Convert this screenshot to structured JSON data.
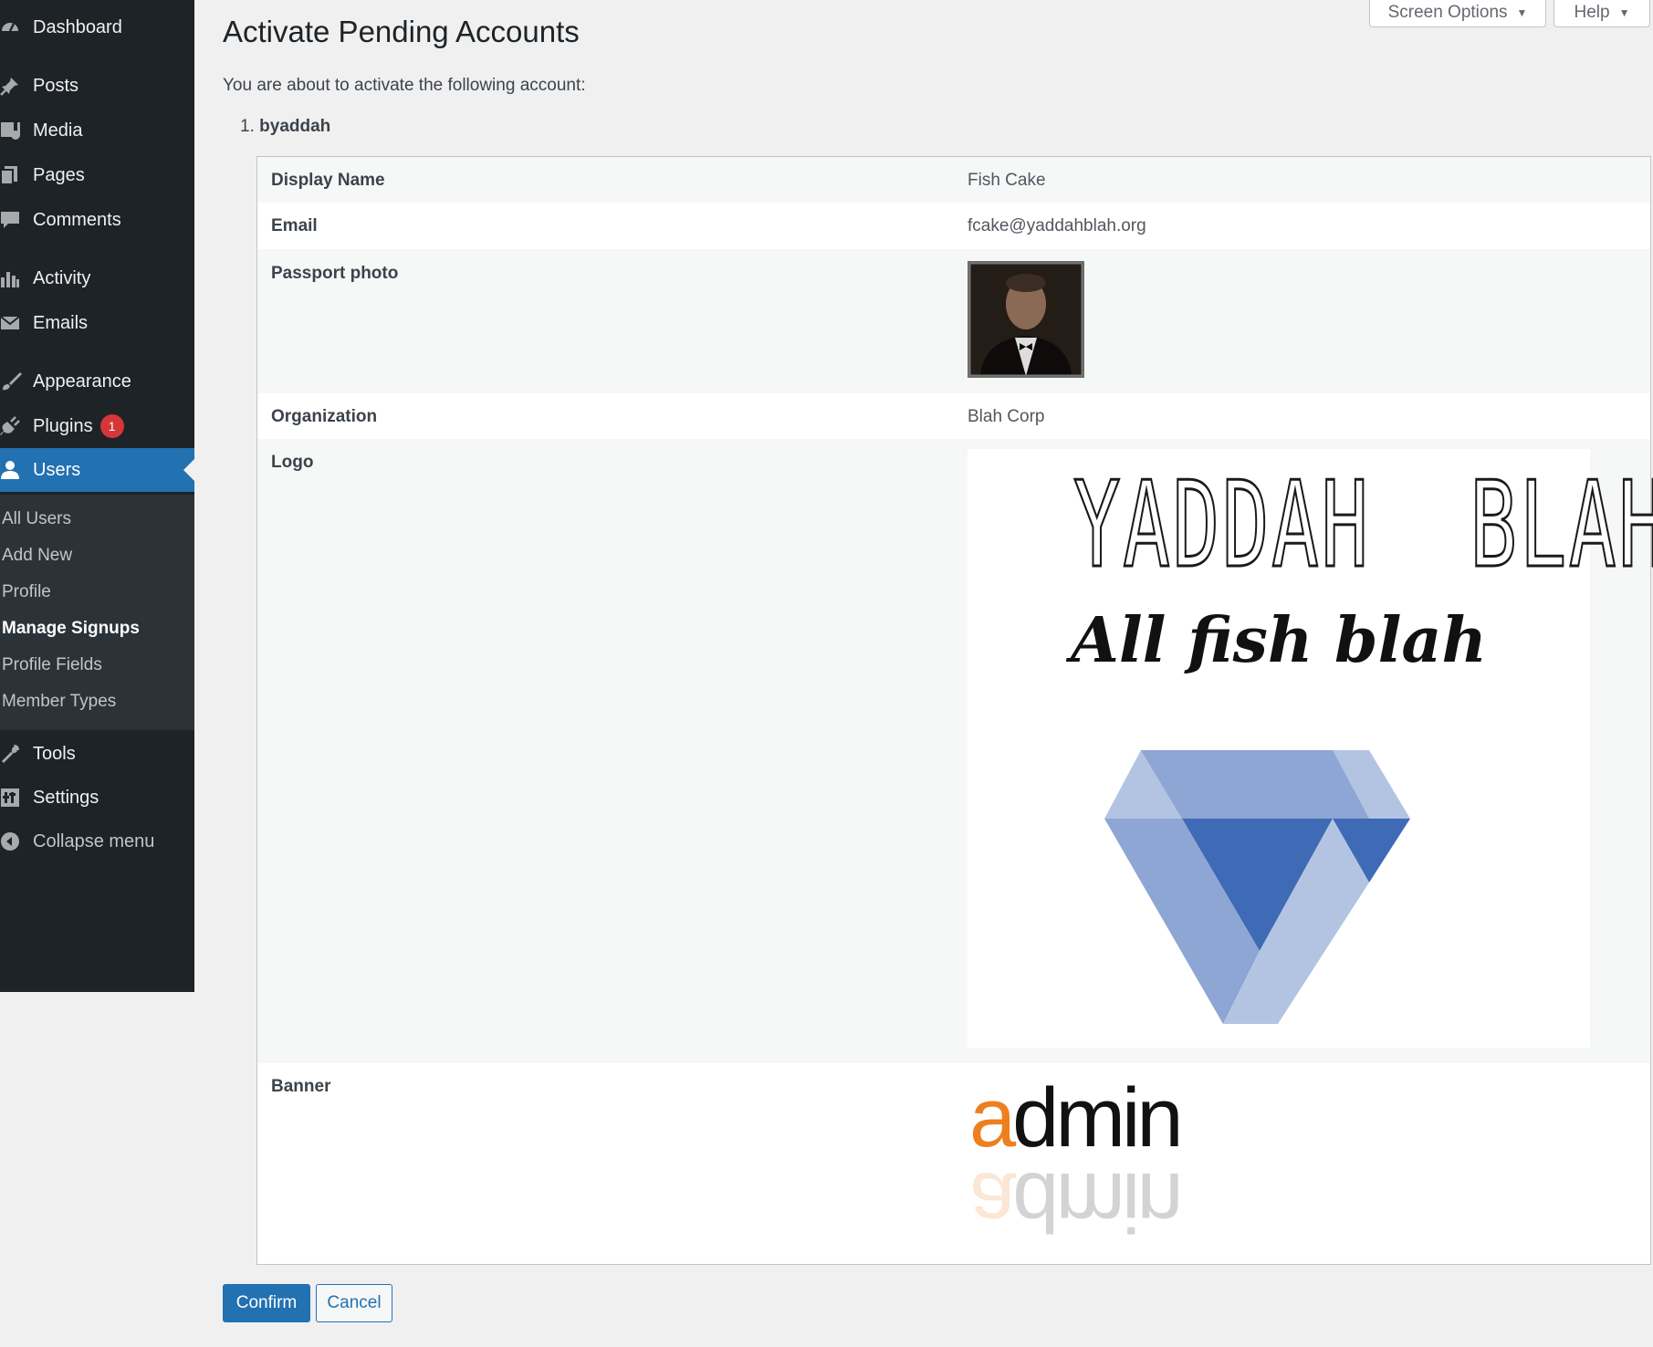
{
  "sidebar": {
    "items": [
      {
        "key": "dashboard",
        "label": "Dashboard",
        "icon": "dashboard-icon"
      },
      {
        "key": "posts",
        "label": "Posts",
        "icon": "pin-icon"
      },
      {
        "key": "media",
        "label": "Media",
        "icon": "media-icon"
      },
      {
        "key": "pages",
        "label": "Pages",
        "icon": "pages-icon"
      },
      {
        "key": "comments",
        "label": "Comments",
        "icon": "comment-icon"
      },
      {
        "key": "activity",
        "label": "Activity",
        "icon": "activity-icon"
      },
      {
        "key": "emails",
        "label": "Emails",
        "icon": "email-icon"
      },
      {
        "key": "appearance",
        "label": "Appearance",
        "icon": "paintbrush-icon"
      },
      {
        "key": "plugins",
        "label": "Plugins",
        "icon": "plugin-icon",
        "badge": "1"
      },
      {
        "key": "users",
        "label": "Users",
        "icon": "user-icon",
        "current": true
      },
      {
        "key": "tools",
        "label": "Tools",
        "icon": "wrench-icon"
      },
      {
        "key": "settings",
        "label": "Settings",
        "icon": "settings-icon"
      },
      {
        "key": "collapse",
        "label": "Collapse menu",
        "icon": "collapse-icon"
      }
    ],
    "submenu": [
      {
        "label": "All Users"
      },
      {
        "label": "Add New"
      },
      {
        "label": "Profile"
      },
      {
        "label": "Manage Signups",
        "active": true
      },
      {
        "label": "Profile Fields"
      },
      {
        "label": "Member Types"
      }
    ]
  },
  "header": {
    "screen_options": "Screen Options",
    "help": "Help"
  },
  "main": {
    "title": "Activate Pending Accounts",
    "intro": "You are about to activate the following account:",
    "account_number": "1.",
    "account_name": "byaddah",
    "fields": {
      "display_name": {
        "label": "Display Name",
        "value": "Fish Cake"
      },
      "email": {
        "label": "Email",
        "value": "fcake@yaddahblah.org"
      },
      "passport_photo": {
        "label": "Passport photo"
      },
      "organization": {
        "label": "Organization",
        "value": "Blah Corp"
      },
      "logo": {
        "label": "Logo",
        "title": "YADDAH  BLAH",
        "tagline": "All fish blah"
      },
      "banner": {
        "label": "Banner",
        "text_a": "a",
        "text_rest": "dmin"
      }
    },
    "buttons": {
      "confirm": "Confirm",
      "cancel": "Cancel"
    }
  },
  "colors": {
    "sidebar_bg": "#1d2327",
    "submenu_bg": "#2c3338",
    "accent": "#2271b1",
    "badge": "#d63638",
    "banner_orange": "#ee7f1e",
    "diamond_light": "#b3c4e3",
    "diamond_mid": "#8ea6d4",
    "diamond_dark": "#3f6ab5"
  }
}
